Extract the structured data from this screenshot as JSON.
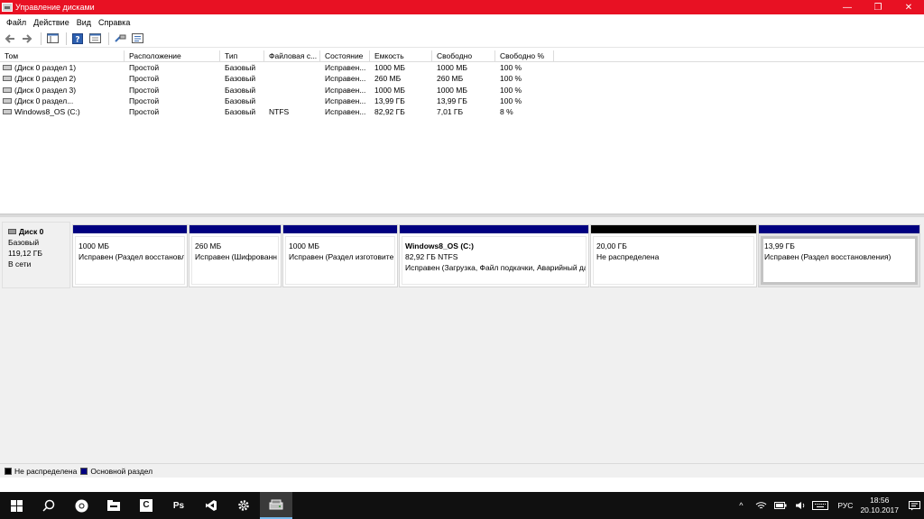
{
  "window": {
    "title": "Управление дисками",
    "minimize_glyph": "—",
    "maximize_glyph": "❐",
    "close_glyph": "✕"
  },
  "menu": [
    "Файл",
    "Действие",
    "Вид",
    "Справка"
  ],
  "toolbar": {
    "icons": [
      "back-icon",
      "forward-icon",
      "console-tree-icon",
      "help-icon",
      "properties-icon",
      "connect-icon",
      "settings-icon"
    ]
  },
  "volume_list": {
    "columns": [
      "Том",
      "Расположение",
      "Тип",
      "Файловая с...",
      "Состояние",
      "Емкость",
      "Свободно",
      "Свободно %"
    ],
    "rows": [
      [
        "(Диск 0 раздел 1)",
        "Простой",
        "Базовый",
        "",
        "Исправен...",
        "1000 МБ",
        "1000 МБ",
        "100 %"
      ],
      [
        "(Диск 0 раздел 2)",
        "Простой",
        "Базовый",
        "",
        "Исправен...",
        "260 МБ",
        "260 МБ",
        "100 %"
      ],
      [
        "(Диск 0 раздел 3)",
        "Простой",
        "Базовый",
        "",
        "Исправен...",
        "1000 МБ",
        "1000 МБ",
        "100 %"
      ],
      [
        "(Диск 0 раздел...",
        "Простой",
        "Базовый",
        "",
        "Исправен...",
        "13,99 ГБ",
        "13,99 ГБ",
        "100 %"
      ],
      [
        "Windows8_OS (C:)",
        "Простой",
        "Базовый",
        "NTFS",
        "Исправен...",
        "82,92 ГБ",
        "7,01 ГБ",
        "8 %"
      ]
    ]
  },
  "disk": {
    "name": "Диск 0",
    "type": "Базовый",
    "size": "119,12 ГБ",
    "status": "В сети",
    "partitions": [
      {
        "name": "",
        "size": "1000 МБ",
        "status": "Исправен (Раздел восстановл",
        "kind": "primary"
      },
      {
        "name": "",
        "size": "260 МБ",
        "status": "Исправен (Шифрованн",
        "kind": "primary"
      },
      {
        "name": "",
        "size": "1000 МБ",
        "status": "Исправен (Раздел изготовите",
        "kind": "primary"
      },
      {
        "name": "Windows8_OS  (C:)",
        "size": "82,92 ГБ NTFS",
        "status": "Исправен (Загрузка, Файл подкачки, Аварийный дамп",
        "kind": "primary"
      },
      {
        "name": "",
        "size": "20,00 ГБ",
        "status": "Не распределена",
        "kind": "unallocated"
      },
      {
        "name": "",
        "size": "13,99 ГБ",
        "status": "Исправен (Раздел восстановления)",
        "kind": "primary"
      }
    ]
  },
  "legend": [
    {
      "label": "Не распределена",
      "color": "#000000"
    },
    {
      "label": "Основной раздел",
      "color": "#000080"
    }
  ],
  "taskbar": {
    "apps": [
      "windows-start-icon",
      "search-icon",
      "chrome-icon",
      "file-explorer-icon",
      "ccleaner-icon",
      "photoshop-icon",
      "visual-studio-icon",
      "settings-icon",
      "disk-management-icon"
    ],
    "ps_label": "Ps",
    "ccleaner_label": "C",
    "tray_chevron": "^",
    "language": "РУС",
    "time": "18:56",
    "date": "20.10.2017"
  },
  "colors": {
    "titlebar": "#e81123",
    "primary_partition": "#000080",
    "unallocated": "#000000",
    "taskbar": "#101010"
  }
}
